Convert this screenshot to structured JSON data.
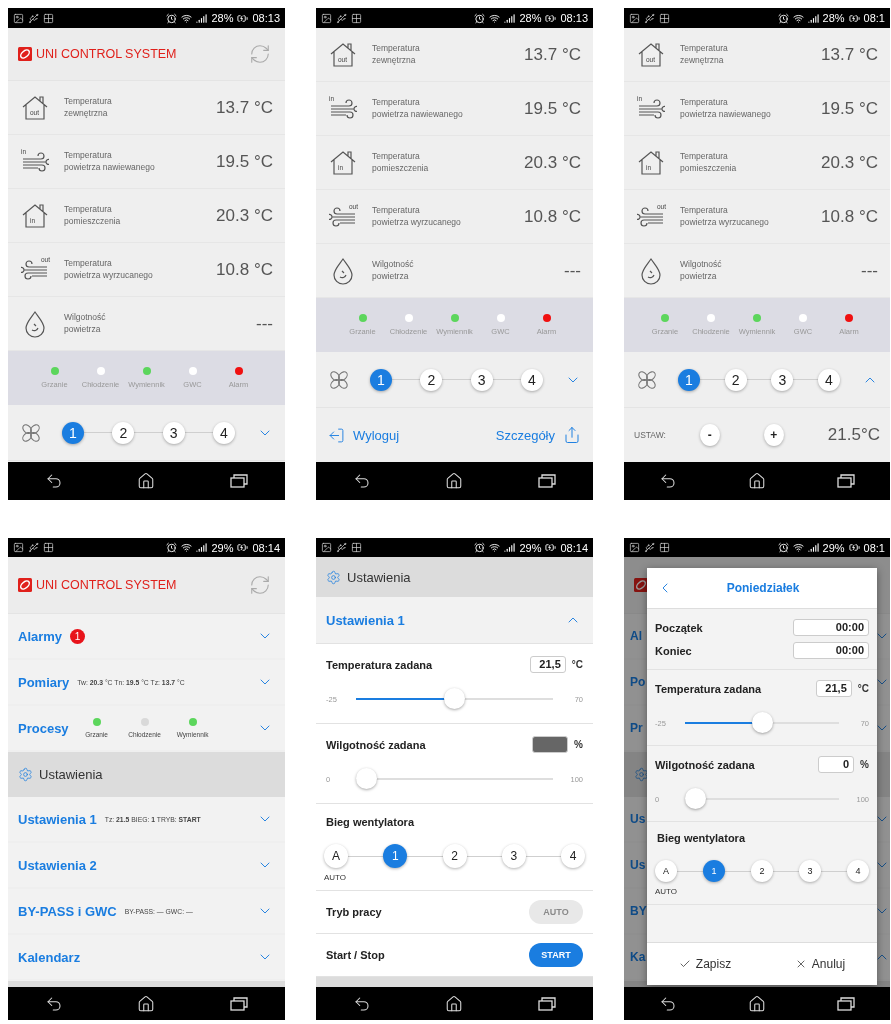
{
  "screens": [
    {
      "kind": "dashboard",
      "status": {
        "battery": "28%",
        "time": "08:13"
      },
      "header": {
        "title": "UNI CONTROL SYSTEM"
      },
      "readings": [
        {
          "kind": "house",
          "tag": "out",
          "label": "Temperatura\nzewnętrzna",
          "value": "13.7 °C"
        },
        {
          "kind": "wind_in",
          "tag": "in",
          "label": "Temperatura\npowietrza nawiewanego",
          "value": "19.5 °C"
        },
        {
          "kind": "house",
          "tag": "in",
          "label": "Temperatura\npomieszczenia",
          "value": "20.3 °C"
        },
        {
          "kind": "wind_out",
          "tag": "out",
          "label": "Temperatura\npowietrza wyrzucanego",
          "value": "10.8 °C"
        },
        {
          "kind": "drop",
          "label": "Wilgotność\npowietrza",
          "value": "---"
        }
      ],
      "processes": [
        {
          "label": "Grzanie",
          "color": "#5cd65c"
        },
        {
          "label": "Chłodzenie",
          "color": "#ffffff"
        },
        {
          "label": "Wymiennik",
          "color": "#5cd65c"
        },
        {
          "label": "GWC",
          "color": "#ffffff"
        },
        {
          "label": "Alarm",
          "color": "#f01010"
        }
      ],
      "fan": {
        "steps": [
          {
            "label": "1",
            "selected": true
          },
          {
            "label": "2",
            "selected": false
          },
          {
            "label": "3",
            "selected": false
          },
          {
            "label": "4",
            "selected": false
          }
        ],
        "expanded": false
      }
    },
    {
      "kind": "dashboard",
      "status": {
        "battery": "28%",
        "time": "08:13"
      },
      "readings": [
        {
          "kind": "house",
          "tag": "out",
          "label": "Temperatura\nzewnętrzna",
          "value": "13.7 °C"
        },
        {
          "kind": "wind_in",
          "tag": "in",
          "label": "Temperatura\npowietrza nawiewanego",
          "value": "19.5 °C"
        },
        {
          "kind": "house",
          "tag": "in",
          "label": "Temperatura\npomieszczenia",
          "value": "20.3 °C"
        },
        {
          "kind": "wind_out",
          "tag": "out",
          "label": "Temperatura\npowietrza wyrzucanego",
          "value": "10.8 °C"
        },
        {
          "kind": "drop",
          "label": "Wilgotność\npowietrza",
          "value": "---"
        }
      ],
      "processes": [
        {
          "label": "Grzanie",
          "color": "#5cd65c"
        },
        {
          "label": "Chłodzenie",
          "color": "#ffffff"
        },
        {
          "label": "Wymiennik",
          "color": "#5cd65c"
        },
        {
          "label": "GWC",
          "color": "#ffffff"
        },
        {
          "label": "Alarm",
          "color": "#f01010"
        }
      ],
      "fan": {
        "steps": [
          {
            "label": "1",
            "selected": true
          },
          {
            "label": "2",
            "selected": false
          },
          {
            "label": "3",
            "selected": false
          },
          {
            "label": "4",
            "selected": false
          }
        ],
        "expanded": false
      },
      "footer": {
        "logout": "Wyloguj",
        "details": "Szczegóły"
      }
    },
    {
      "kind": "dashboard",
      "status": {
        "battery": "28%",
        "time": "08:1"
      },
      "readings": [
        {
          "kind": "house",
          "tag": "out",
          "label": "Temperatura\nzewnętrzna",
          "value": "13.7 °C"
        },
        {
          "kind": "wind_in",
          "tag": "in",
          "label": "Temperatura\npowietrza nawiewanego",
          "value": "19.5 °C"
        },
        {
          "kind": "house",
          "tag": "in",
          "label": "Temperatura\npomieszczenia",
          "value": "20.3 °C"
        },
        {
          "kind": "wind_out",
          "tag": "out",
          "label": "Temperatura\npowietrza wyrzucanego",
          "value": "10.8 °C"
        },
        {
          "kind": "drop",
          "label": "Wilgotność\npowietrza",
          "value": "---"
        }
      ],
      "processes": [
        {
          "label": "Grzanie",
          "color": "#5cd65c"
        },
        {
          "label": "Chłodzenie",
          "color": "#ffffff"
        },
        {
          "label": "Wymiennik",
          "color": "#5cd65c"
        },
        {
          "label": "GWC",
          "color": "#ffffff"
        },
        {
          "label": "Alarm",
          "color": "#f01010"
        }
      ],
      "fan": {
        "steps": [
          {
            "label": "1",
            "selected": true
          },
          {
            "label": "2",
            "selected": false
          },
          {
            "label": "3",
            "selected": false
          },
          {
            "label": "4",
            "selected": false
          }
        ],
        "expanded": true
      },
      "setpoint": {
        "label": "USTAW:",
        "minus": "-",
        "plus": "+",
        "value": "21.5°C"
      }
    },
    {
      "kind": "menu",
      "status": {
        "battery": "29%",
        "time": "08:14"
      },
      "header": {
        "title": "UNI CONTROL SYSTEM"
      },
      "items": [
        {
          "kind": "section",
          "title": "Alarmy",
          "badge": "1",
          "expanded": false
        },
        {
          "kind": "section",
          "title": "Pomiary",
          "summary": "Tw: **20.3** °C Tn: **19.5** °C Tz: **13.7** °C",
          "expanded": false
        },
        {
          "kind": "section",
          "title": "Procesy",
          "processes": [
            {
              "label": "Grzanie",
              "color": "#5cd65c"
            },
            {
              "label": "Chłodzenie",
              "color": "#d9d9d9"
            },
            {
              "label": "Wymiennik",
              "color": "#5cd65c"
            }
          ],
          "expanded": false
        },
        {
          "kind": "group",
          "title": "Ustawienia"
        },
        {
          "kind": "section",
          "title": "Ustawienia 1",
          "summary": "Tz: **21.5** BIEG: **1** TRYB: **START**",
          "expanded": false
        },
        {
          "kind": "section",
          "title": "Ustawienia 2",
          "expanded": false
        },
        {
          "kind": "section",
          "title": "BY-PASS i GWC",
          "summary": "BY-PASS: — GWC: —",
          "expanded": false
        },
        {
          "kind": "section",
          "title": "Kalendarz",
          "expanded": false
        }
      ]
    },
    {
      "kind": "settings",
      "status": {
        "battery": "29%",
        "time": "08:14"
      },
      "group": {
        "title": "Ustawienia"
      },
      "section": {
        "title": "Ustawienia 1",
        "expanded": true
      },
      "settings": {
        "temperature": {
          "label": "Temperatura zadana",
          "value": "21,5",
          "unit": "°C",
          "min": "-25",
          "max": "70",
          "level": 0.5
        },
        "humidity": {
          "label": "Wilgotność zadana",
          "unit": "%",
          "min": "0",
          "max": "100",
          "level": 0,
          "disabled": true
        },
        "fan": {
          "label": "Bieg wentylatora",
          "steps": [
            {
              "label": "A",
              "caption": "AUTO",
              "selected": false
            },
            {
              "label": "1",
              "selected": true
            },
            {
              "label": "2",
              "selected": false
            },
            {
              "label": "3",
              "selected": false
            },
            {
              "label": "4",
              "selected": false
            }
          ]
        }
      },
      "mode": {
        "label": "Tryb pracy",
        "button": "AUTO",
        "disabled": true
      },
      "start": {
        "label": "Start / Stop",
        "button": "START",
        "disabled": false
      }
    },
    {
      "kind": "dialog",
      "status": {
        "battery": "29%",
        "time": "08:1"
      },
      "background": [
        {
          "kind": "section",
          "title": "Al",
          "expanded": false
        },
        {
          "kind": "section",
          "title": "Po",
          "expanded": false
        },
        {
          "kind": "section",
          "title": "Pr",
          "expanded": false
        },
        {
          "kind": "group"
        },
        {
          "kind": "section",
          "title": "Us",
          "expanded": false
        },
        {
          "kind": "section",
          "title": "Us",
          "expanded": false
        },
        {
          "kind": "section",
          "title": "BY",
          "expanded": false
        },
        {
          "kind": "section",
          "title": "Ka",
          "expanded": true
        }
      ],
      "dialog": {
        "title": "Poniedziałek",
        "times": [
          {
            "label": "Początek",
            "value": "00:00"
          },
          {
            "label": "Koniec",
            "value": "00:00"
          }
        ],
        "settings": {
          "temperature": {
            "label": "Temperatura zadana",
            "value": "21,5",
            "unit": "°C",
            "min": "-25",
            "max": "70",
            "level": 0.5
          },
          "humidity": {
            "label": "Wilgotność zadana",
            "value": "0",
            "unit": "%",
            "min": "0",
            "max": "100",
            "level": 0,
            "disabled": false
          },
          "fan": {
            "label": "Bieg wentylatora",
            "steps": [
              {
                "label": "A",
                "caption": "AUTO",
                "selected": false
              },
              {
                "label": "1",
                "selected": true
              },
              {
                "label": "2",
                "selected": false
              },
              {
                "label": "3",
                "selected": false
              },
              {
                "label": "4",
                "selected": false
              }
            ]
          }
        },
        "save": "Zapisz",
        "cancel": "Anuluj"
      }
    }
  ]
}
